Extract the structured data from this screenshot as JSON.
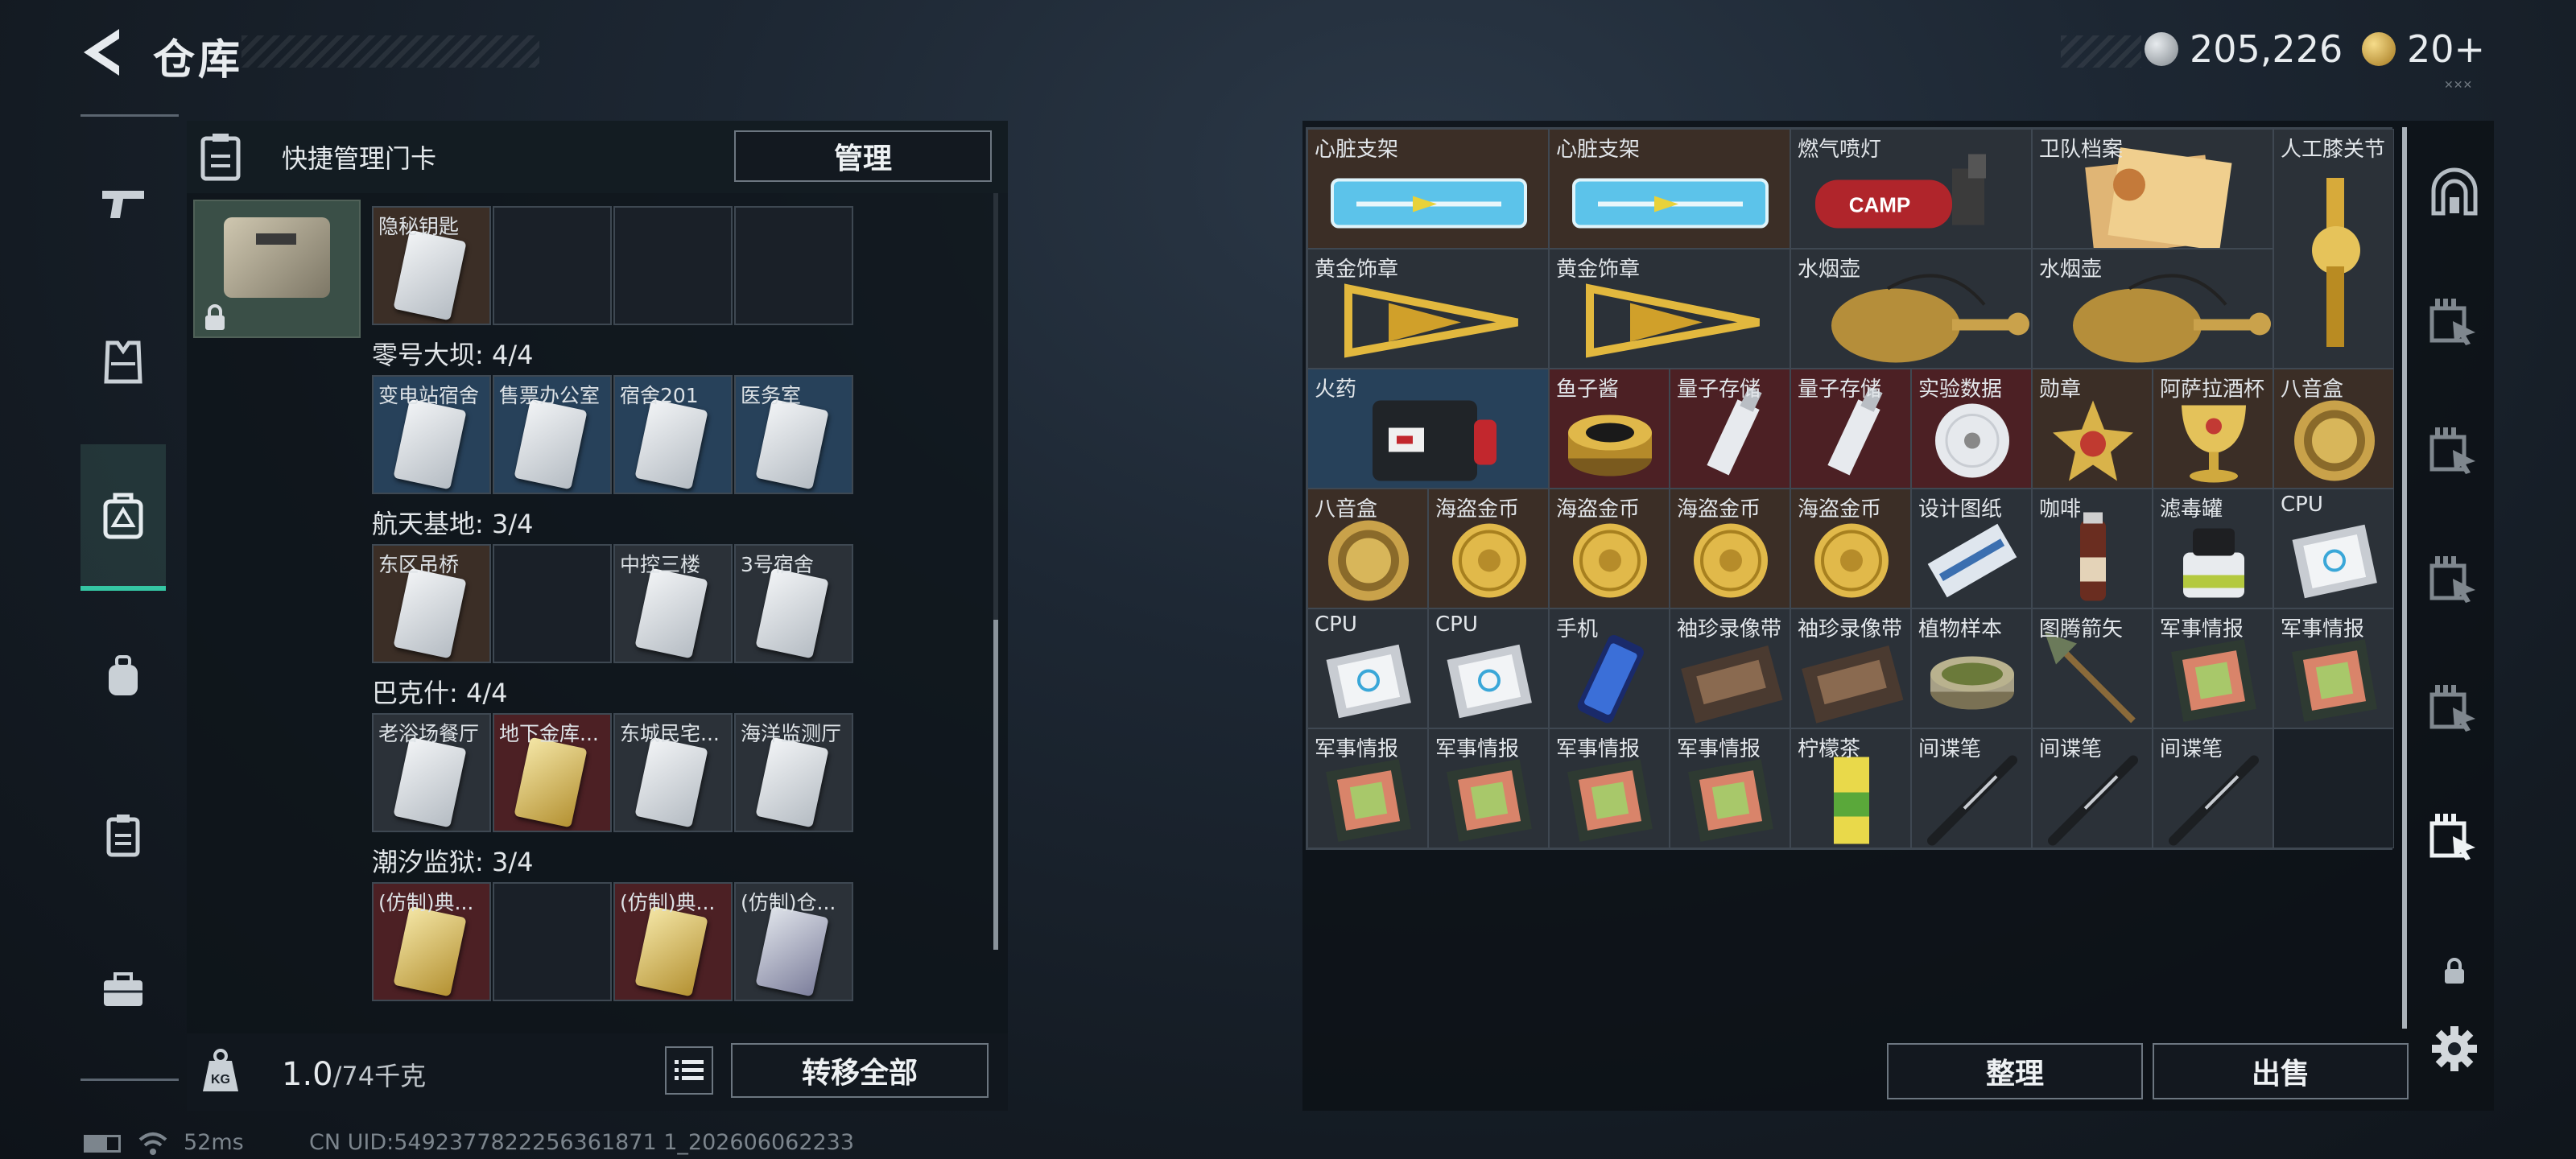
{
  "header": {
    "title": "仓库",
    "back_icon": "chevron-left-icon"
  },
  "currency": [
    {
      "icon": "silver-coin-icon",
      "value": "205,226",
      "color": "#9aa3ab"
    },
    {
      "icon": "gold-coin-icon",
      "value": "20+",
      "color": "#d9b44a"
    }
  ],
  "left_nav": [
    {
      "icon": "pistol-icon"
    },
    {
      "icon": "vest-icon"
    },
    {
      "icon": "keycard-bag-icon",
      "active": true
    },
    {
      "icon": "backpack-icon"
    },
    {
      "icon": "keycard-icon"
    },
    {
      "icon": "toolbox-icon"
    }
  ],
  "keycard_panel": {
    "title": "快捷管理门卡",
    "manage_label": "管理",
    "sections": [
      {
        "title": "",
        "slots": [
          {
            "label": "隐秘钥匙",
            "color": "brown",
            "card": "silver"
          },
          {
            "label": "",
            "color": "empty"
          },
          {
            "label": "",
            "color": "empty"
          },
          {
            "label": "",
            "color": "empty"
          }
        ]
      },
      {
        "title": "零号大坝: 4/4",
        "slots": [
          {
            "label": "变电站宿舍",
            "color": "blue",
            "card": "silver"
          },
          {
            "label": "售票办公室",
            "color": "blue",
            "card": "silver"
          },
          {
            "label": "宿舍201",
            "color": "blue",
            "card": "silver"
          },
          {
            "label": "医务室",
            "color": "blue",
            "card": "silver"
          }
        ]
      },
      {
        "title": "航天基地: 3/4",
        "slots": [
          {
            "label": "东区吊桥",
            "color": "brown",
            "card": "silver"
          },
          {
            "label": "",
            "color": "empty"
          },
          {
            "label": "中控三楼",
            "color": "grey",
            "card": "silver"
          },
          {
            "label": "3号宿舍",
            "color": "grey",
            "card": "silver"
          }
        ]
      },
      {
        "title": "巴克什: 4/4",
        "slots": [
          {
            "label": "老浴场餐厅",
            "color": "grey",
            "card": "silver"
          },
          {
            "label": "地下金库...",
            "color": "red",
            "card": "gold"
          },
          {
            "label": "东城民宅...",
            "color": "grey",
            "card": "silver"
          },
          {
            "label": "海洋监测厅",
            "color": "grey",
            "card": "silver"
          }
        ]
      },
      {
        "title": "潮汐监狱: 3/4",
        "slots": [
          {
            "label": "(仿制)典...",
            "color": "red",
            "card": "gold"
          },
          {
            "label": "",
            "color": "empty"
          },
          {
            "label": "(仿制)典...",
            "color": "red",
            "card": "gold"
          },
          {
            "label": "(仿制)仓...",
            "color": "grey",
            "card": "dark"
          }
        ]
      }
    ],
    "footer": {
      "weight_value": "1.0",
      "weight_capacity": "/74千克",
      "transfer_all_label": "转移全部",
      "kg_icon": "weight-kg-icon",
      "list_icon": "list-icon"
    }
  },
  "status_bar": {
    "ping": "52ms",
    "uid": "CN UID:5492377822256361871 1_202606062233"
  },
  "stash": {
    "items": [
      {
        "label": "心脏支架",
        "color": "brown",
        "icon": "stent-icon",
        "w": 2,
        "h": 1
      },
      {
        "label": "心脏支架",
        "color": "brown",
        "icon": "stent-icon",
        "w": 2,
        "h": 1
      },
      {
        "label": "燃气喷灯",
        "color": "grey",
        "icon": "torch-icon",
        "w": 2,
        "h": 1
      },
      {
        "label": "卫队档案",
        "color": "grey",
        "icon": "dossier-icon",
        "w": 2,
        "h": 1
      },
      {
        "label": "人工膝关节",
        "color": "grey",
        "icon": "knee-joint-icon",
        "w": 1,
        "h": 2
      },
      {
        "label": "黄金饰章",
        "color": "grey",
        "icon": "gold-emblem-icon",
        "w": 2,
        "h": 1
      },
      {
        "label": "黄金饰章",
        "color": "grey",
        "icon": "gold-emblem-icon",
        "w": 2,
        "h": 1
      },
      {
        "label": "水烟壶",
        "color": "grey",
        "icon": "hookah-icon",
        "w": 2,
        "h": 1
      },
      {
        "label": "水烟壶",
        "color": "grey",
        "icon": "hookah-icon",
        "w": 2,
        "h": 1
      },
      {
        "label": "火药",
        "color": "blue",
        "icon": "gunpowder-icon",
        "w": 2,
        "h": 1
      },
      {
        "label": "鱼子酱",
        "color": "red",
        "icon": "caviar-icon",
        "w": 1,
        "h": 1
      },
      {
        "label": "量子存储",
        "color": "red",
        "icon": "usb-drive-icon",
        "w": 1,
        "h": 1
      },
      {
        "label": "量子存储",
        "color": "red",
        "icon": "usb-drive-icon",
        "w": 1,
        "h": 1
      },
      {
        "label": "实验数据",
        "color": "red",
        "icon": "disc-icon",
        "w": 1,
        "h": 1
      },
      {
        "label": "勋章",
        "color": "brown",
        "icon": "medal-icon",
        "w": 1,
        "h": 1
      },
      {
        "label": "阿萨拉酒杯",
        "color": "brown",
        "icon": "goblet-icon",
        "w": 1,
        "h": 1
      },
      {
        "label": "八音盒",
        "color": "brown",
        "icon": "music-box-icon",
        "w": 1,
        "h": 1
      },
      {
        "label": "八音盒",
        "color": "brown",
        "icon": "music-box-icon",
        "w": 1,
        "h": 1
      },
      {
        "label": "海盗金币",
        "color": "brown",
        "icon": "gold-coin-icon",
        "w": 1,
        "h": 1
      },
      {
        "label": "海盗金币",
        "color": "brown",
        "icon": "gold-coin-icon",
        "w": 1,
        "h": 1
      },
      {
        "label": "海盗金币",
        "color": "brown",
        "icon": "gold-coin-icon",
        "w": 1,
        "h": 1
      },
      {
        "label": "海盗金币",
        "color": "brown",
        "icon": "gold-coin-icon",
        "w": 1,
        "h": 1
      },
      {
        "label": "设计图纸",
        "color": "grey",
        "icon": "blueprint-icon",
        "w": 1,
        "h": 1
      },
      {
        "label": "咖啡",
        "color": "grey",
        "icon": "coffee-bottle-icon",
        "w": 1,
        "h": 1
      },
      {
        "label": "滤毒罐",
        "color": "grey",
        "icon": "filter-canister-icon",
        "w": 1,
        "h": 1
      },
      {
        "label": "CPU",
        "color": "grey",
        "icon": "cpu-icon",
        "w": 1,
        "h": 1
      },
      {
        "label": "CPU",
        "color": "grey",
        "icon": "cpu-icon",
        "w": 1,
        "h": 1
      },
      {
        "label": "CPU",
        "color": "grey",
        "icon": "cpu-icon",
        "w": 1,
        "h": 1
      },
      {
        "label": "手机",
        "color": "grey",
        "icon": "phone-icon",
        "w": 1,
        "h": 1
      },
      {
        "label": "袖珍录像带",
        "color": "grey",
        "icon": "cassette-icon",
        "w": 1,
        "h": 1
      },
      {
        "label": "袖珍录像带",
        "color": "grey",
        "icon": "cassette-icon",
        "w": 1,
        "h": 1
      },
      {
        "label": "植物样本",
        "color": "grey",
        "icon": "petri-dish-icon",
        "w": 1,
        "h": 1
      },
      {
        "label": "图腾箭矢",
        "color": "grey",
        "icon": "arrow-icon",
        "w": 1,
        "h": 1
      },
      {
        "label": "军事情报",
        "color": "grey",
        "icon": "intel-board-icon",
        "w": 1,
        "h": 1
      },
      {
        "label": "军事情报",
        "color": "grey",
        "icon": "intel-board-icon",
        "w": 1,
        "h": 1
      },
      {
        "label": "军事情报",
        "color": "grey",
        "icon": "intel-board-icon",
        "w": 1,
        "h": 1
      },
      {
        "label": "军事情报",
        "color": "grey",
        "icon": "intel-board-icon",
        "w": 1,
        "h": 1
      },
      {
        "label": "军事情报",
        "color": "grey",
        "icon": "intel-board-icon",
        "w": 1,
        "h": 1
      },
      {
        "label": "军事情报",
        "color": "grey",
        "icon": "intel-board-icon",
        "w": 1,
        "h": 1
      },
      {
        "label": "柠檬茶",
        "color": "grey",
        "icon": "drink-box-icon",
        "w": 1,
        "h": 1
      },
      {
        "label": "间谍笔",
        "color": "grey",
        "icon": "spy-pen-icon",
        "w": 1,
        "h": 1
      },
      {
        "label": "间谍笔",
        "color": "grey",
        "icon": "spy-pen-icon",
        "w": 1,
        "h": 1
      },
      {
        "label": "间谍笔",
        "color": "grey",
        "icon": "spy-pen-icon",
        "w": 1,
        "h": 1
      }
    ],
    "sort_label": "整理",
    "sell_label": "出售"
  },
  "right_tabs": [
    {
      "icon": "arch-icon"
    },
    {
      "icon": "stash-tab-icon"
    },
    {
      "icon": "stash-tab-icon"
    },
    {
      "icon": "stash-tab-icon"
    },
    {
      "icon": "stash-tab-icon"
    },
    {
      "icon": "stash-tab-icon",
      "active": true
    },
    {
      "icon": "lock-icon"
    },
    {
      "icon": "gear-icon"
    }
  ],
  "colors": {
    "accent": "#35c6a3",
    "blue": "#27415a",
    "brown": "#3b2e26",
    "red": "#4c2024",
    "grey": "#2b3138"
  }
}
